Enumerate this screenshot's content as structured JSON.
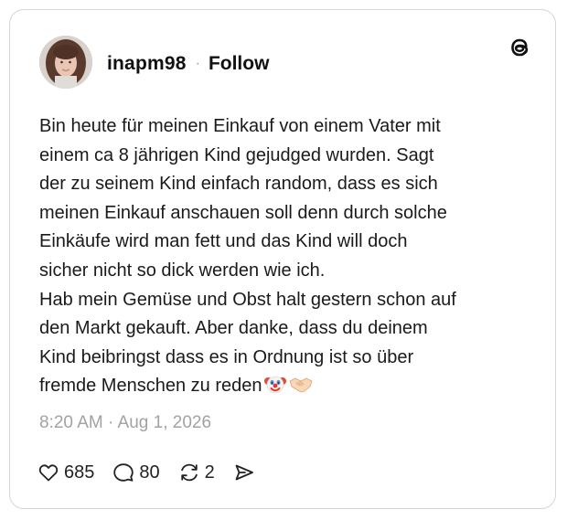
{
  "post": {
    "username": "inapm98",
    "separator": "·",
    "follow_label": "Follow",
    "body_lines": [
      "Bin heute für meinen Einkauf von einem Vater mit",
      "einem ca 8 jährigen Kind gejudged wurden. Sagt",
      "der zu seinem Kind einfach random, dass es sich",
      "meinen Einkauf anschauen soll denn durch solche",
      "Einkäufe wird man fett und das Kind will doch",
      "sicher nicht so dick werden wie ich.",
      "Hab mein Gemüse und Obst halt gestern schon auf",
      "den Markt gekauft. Aber danke, dass du deinem",
      "Kind beibringst dass es in Ordnung ist so über",
      "fremde Menschen zu reden"
    ],
    "trailing_emojis": [
      "clown-face-icon",
      "handshake-icon"
    ],
    "timestamp": "8:20 AM · Aug 1, 2026",
    "likes": "685",
    "replies": "80",
    "reposts": "2"
  },
  "icons": {
    "brand": "threads-logo-icon",
    "like": "heart-icon",
    "reply": "speech-bubble-icon",
    "repost": "repost-icon",
    "share": "send-icon"
  },
  "colors": {
    "text": "#1a1a1a",
    "muted": "#a2a2a2",
    "border": "#d6d6d6"
  }
}
